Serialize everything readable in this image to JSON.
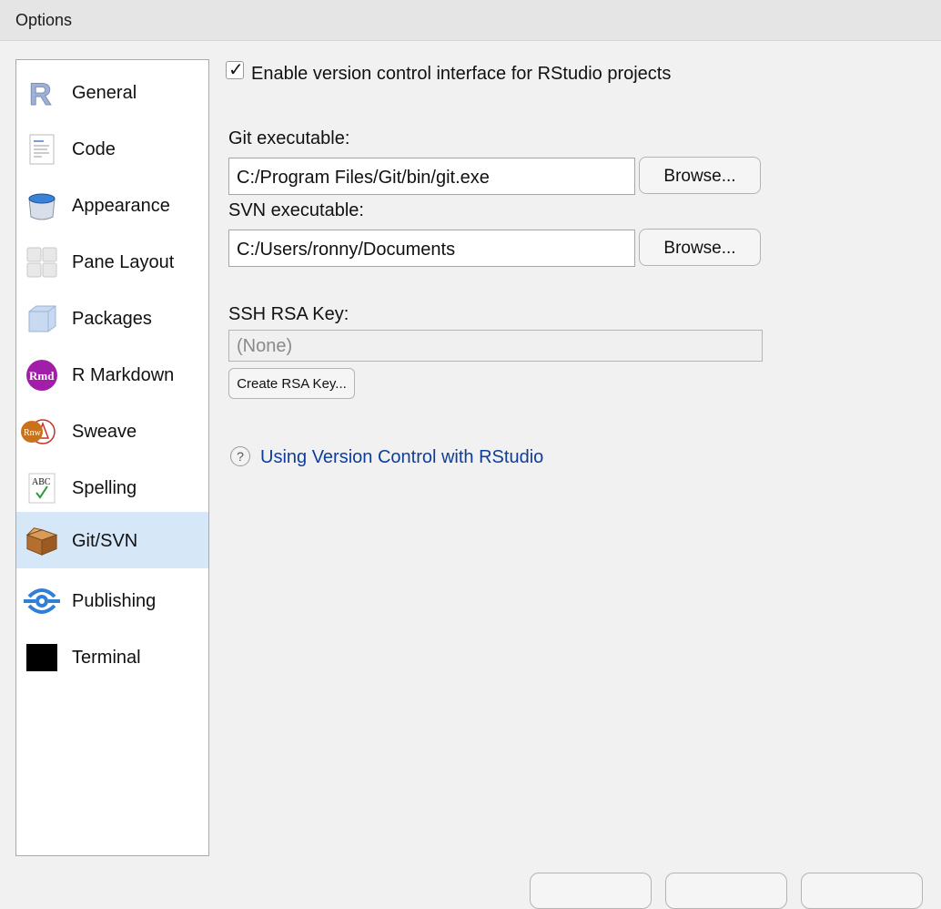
{
  "window": {
    "title": "Options"
  },
  "sidebar": {
    "items": [
      {
        "label": "General",
        "icon": "r-logo-icon"
      },
      {
        "label": "Code",
        "icon": "code-document-icon"
      },
      {
        "label": "Appearance",
        "icon": "paint-bucket-icon"
      },
      {
        "label": "Pane Layout",
        "icon": "pane-layout-icon"
      },
      {
        "label": "Packages",
        "icon": "package-cube-icon"
      },
      {
        "label": "R Markdown",
        "icon": "rmd-icon"
      },
      {
        "label": "Sweave",
        "icon": "sweave-icon"
      },
      {
        "label": "Spelling",
        "icon": "spelling-abc-icon"
      },
      {
        "label": "Git/SVN",
        "icon": "cardboard-box-icon",
        "selected": true
      },
      {
        "label": "Publishing",
        "icon": "publishing-icon"
      },
      {
        "label": "Terminal",
        "icon": "terminal-icon"
      }
    ]
  },
  "git": {
    "enable_label": "Enable version control interface for RStudio projects",
    "enable_checked": true,
    "git_exe_label": "Git executable:",
    "git_exe_value": "C:/Program Files/Git/bin/git.exe",
    "browse_label": "Browse...",
    "svn_exe_label": "SVN executable:",
    "svn_exe_value": "C:/Users/ronny/Documents",
    "ssh_label": "SSH RSA Key:",
    "ssh_value": "(None)",
    "create_key_label": "Create RSA Key...",
    "help_icon": "help-circle-icon",
    "help_link": "Using Version Control with RStudio"
  },
  "colors": {
    "selected_bg": "#d6e7f7",
    "link": "#0e3d9b"
  }
}
